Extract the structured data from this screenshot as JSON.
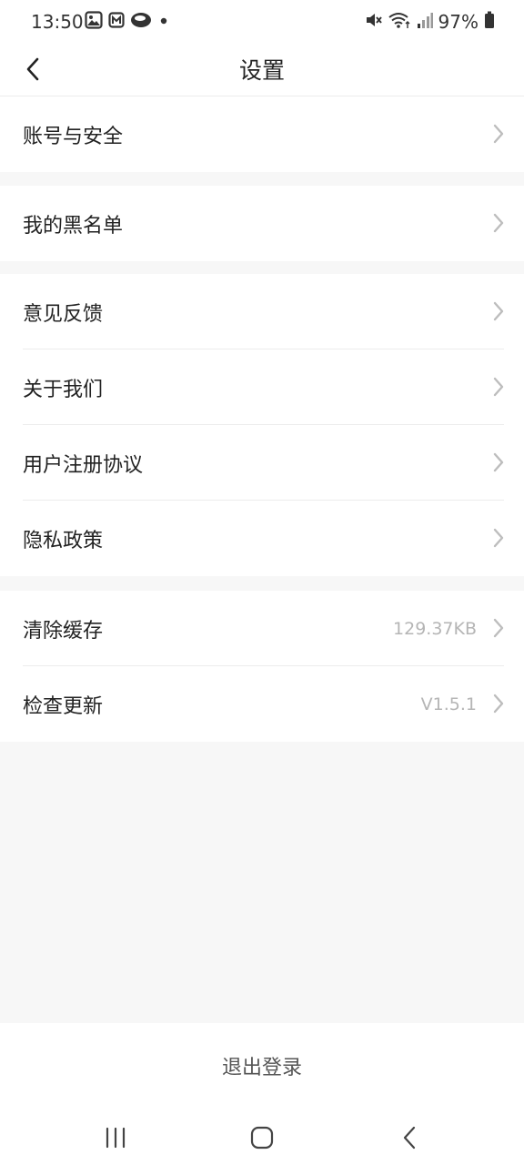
{
  "status_bar": {
    "time": "13:50",
    "battery_percent": "97%",
    "left_icons": [
      "gallery-icon",
      "app-m-icon",
      "cloud-app-icon",
      "notification-dot-icon"
    ],
    "right_icons": [
      "mute-icon",
      "wifi-icon",
      "signal-icon",
      "battery-icon"
    ]
  },
  "nav": {
    "title": "设置",
    "back_icon": "chevron-left-icon"
  },
  "groups": [
    {
      "items": [
        {
          "label": "账号与安全",
          "value": ""
        }
      ]
    },
    {
      "items": [
        {
          "label": "我的黑名单",
          "value": ""
        }
      ]
    },
    {
      "items": [
        {
          "label": "意见反馈",
          "value": ""
        },
        {
          "label": "关于我们",
          "value": ""
        },
        {
          "label": "用户注册协议",
          "value": ""
        },
        {
          "label": "隐私政策",
          "value": ""
        }
      ]
    },
    {
      "items": [
        {
          "label": "清除缓存",
          "value": "129.37KB"
        },
        {
          "label": "检查更新",
          "value": "V1.5.1"
        }
      ]
    }
  ],
  "logout": {
    "label": "退出登录"
  },
  "system_nav": [
    "recent-apps-icon",
    "home-icon",
    "back-icon"
  ],
  "colors": {
    "background": "#f7f7f7",
    "surface": "#ffffff",
    "text_primary": "#222222",
    "text_secondary": "#b5b5b5",
    "divider": "#ececec"
  }
}
